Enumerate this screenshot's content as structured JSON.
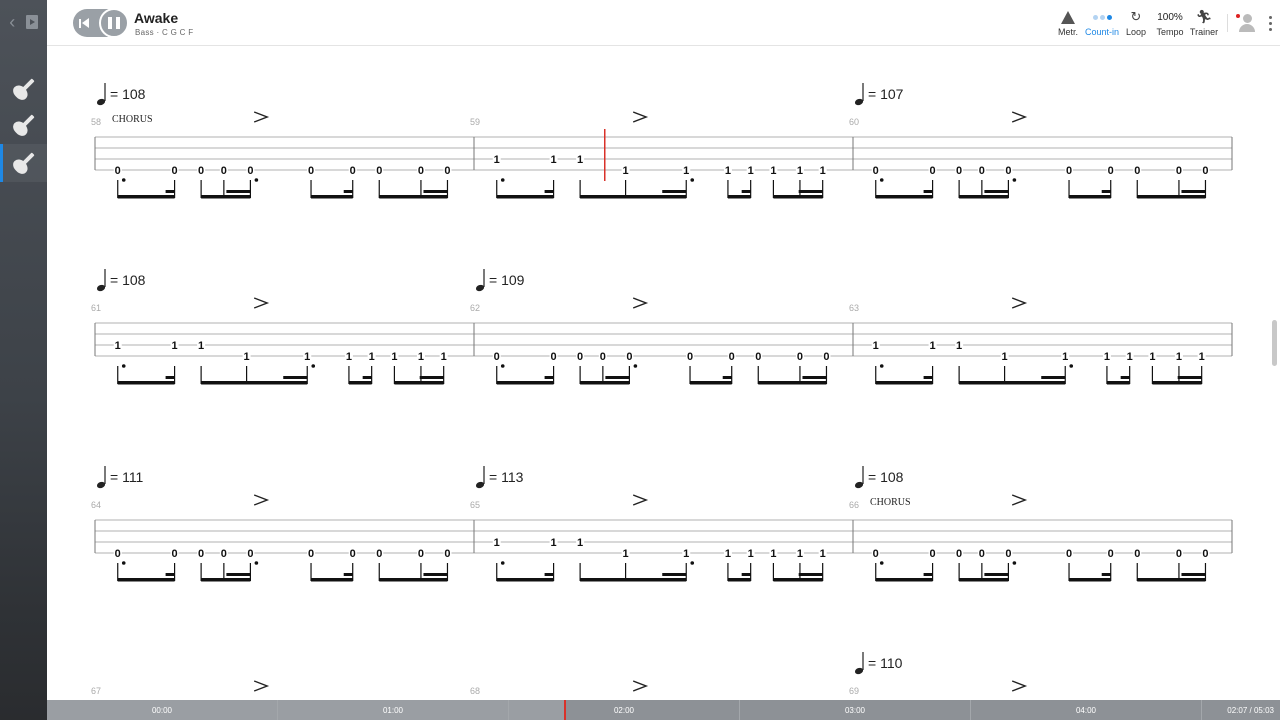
{
  "song": {
    "title": "Awake",
    "subtitle": "Bass · C G C F"
  },
  "toolbar": {
    "metronome": "Metr.",
    "count_in": "Count-in",
    "loop": "Loop",
    "tempo_value": "100%",
    "tempo": "Tempo",
    "trainer": "Trainer"
  },
  "timeline": {
    "labels": [
      "00:00",
      "01:00",
      "02:00",
      "03:00",
      "04:00"
    ],
    "position": "02:07 / 05:03",
    "progress": 0.4196,
    "accent_color": "#d9322a"
  },
  "accent": "#1e88e5",
  "score": {
    "systems": [
      {
        "measures": [
          {
            "number": "58",
            "tempo": "= 108",
            "section": "CHORUS",
            "pattern": "A"
          },
          {
            "number": "59",
            "tempo": "",
            "section": "",
            "pattern": "B"
          },
          {
            "number": "60",
            "tempo": "= 107",
            "section": "",
            "pattern": "A"
          }
        ]
      },
      {
        "measures": [
          {
            "number": "61",
            "tempo": "= 108",
            "section": "",
            "pattern": "C"
          },
          {
            "number": "62",
            "tempo": "= 109",
            "section": "",
            "pattern": "A"
          },
          {
            "number": "63",
            "tempo": "",
            "section": "",
            "pattern": "C"
          }
        ]
      },
      {
        "measures": [
          {
            "number": "64",
            "tempo": "= 111",
            "section": "",
            "pattern": "A"
          },
          {
            "number": "65",
            "tempo": "= 113",
            "section": "",
            "pattern": "B"
          },
          {
            "number": "66",
            "tempo": "= 108",
            "section": "CHORUS",
            "pattern": "A"
          }
        ]
      },
      {
        "measures": [
          {
            "number": "67",
            "tempo": "",
            "section": "",
            "pattern": "A"
          },
          {
            "number": "68",
            "tempo": "",
            "section": "",
            "pattern": "A"
          },
          {
            "number": "69",
            "tempo": "= 110",
            "section": "",
            "pattern": "A"
          }
        ]
      }
    ],
    "patterns": {
      "A": {
        "notes": [
          {
            "x": 0.06,
            "s": 3,
            "f": "0"
          },
          {
            "x": 0.21,
            "s": 3,
            "f": "0"
          },
          {
            "x": 0.28,
            "s": 3,
            "f": "0"
          },
          {
            "x": 0.34,
            "s": 3,
            "f": "0"
          },
          {
            "x": 0.41,
            "s": 3,
            "f": "0"
          },
          {
            "x": 0.57,
            "s": 3,
            "f": "0"
          },
          {
            "x": 0.68,
            "s": 3,
            "f": "0"
          },
          {
            "x": 0.75,
            "s": 3,
            "f": "0"
          },
          {
            "x": 0.86,
            "s": 3,
            "f": "0"
          },
          {
            "x": 0.93,
            "s": 3,
            "f": "0"
          }
        ]
      },
      "B": {
        "notes": [
          {
            "x": 0.06,
            "s": 2,
            "f": "1"
          },
          {
            "x": 0.21,
            "s": 2,
            "f": "1"
          },
          {
            "x": 0.28,
            "s": 2,
            "f": "1"
          },
          {
            "x": 0.4,
            "s": 3,
            "f": "1"
          },
          {
            "x": 0.56,
            "s": 3,
            "f": "1"
          },
          {
            "x": 0.67,
            "s": 3,
            "f": "1"
          },
          {
            "x": 0.73,
            "s": 3,
            "f": "1"
          },
          {
            "x": 0.79,
            "s": 3,
            "f": "1"
          },
          {
            "x": 0.86,
            "s": 3,
            "f": "1"
          },
          {
            "x": 0.92,
            "s": 3,
            "f": "1"
          }
        ]
      },
      "C": {
        "notes": [
          {
            "x": 0.06,
            "s": 2,
            "f": "1"
          },
          {
            "x": 0.21,
            "s": 2,
            "f": "1"
          },
          {
            "x": 0.28,
            "s": 2,
            "f": "1"
          },
          {
            "x": 0.4,
            "s": 3,
            "f": "1"
          },
          {
            "x": 0.56,
            "s": 3,
            "f": "1"
          },
          {
            "x": 0.67,
            "s": 3,
            "f": "1"
          },
          {
            "x": 0.73,
            "s": 3,
            "f": "1"
          },
          {
            "x": 0.79,
            "s": 3,
            "f": "1"
          },
          {
            "x": 0.86,
            "s": 3,
            "f": "1"
          },
          {
            "x": 0.92,
            "s": 3,
            "f": "1"
          }
        ]
      }
    }
  }
}
